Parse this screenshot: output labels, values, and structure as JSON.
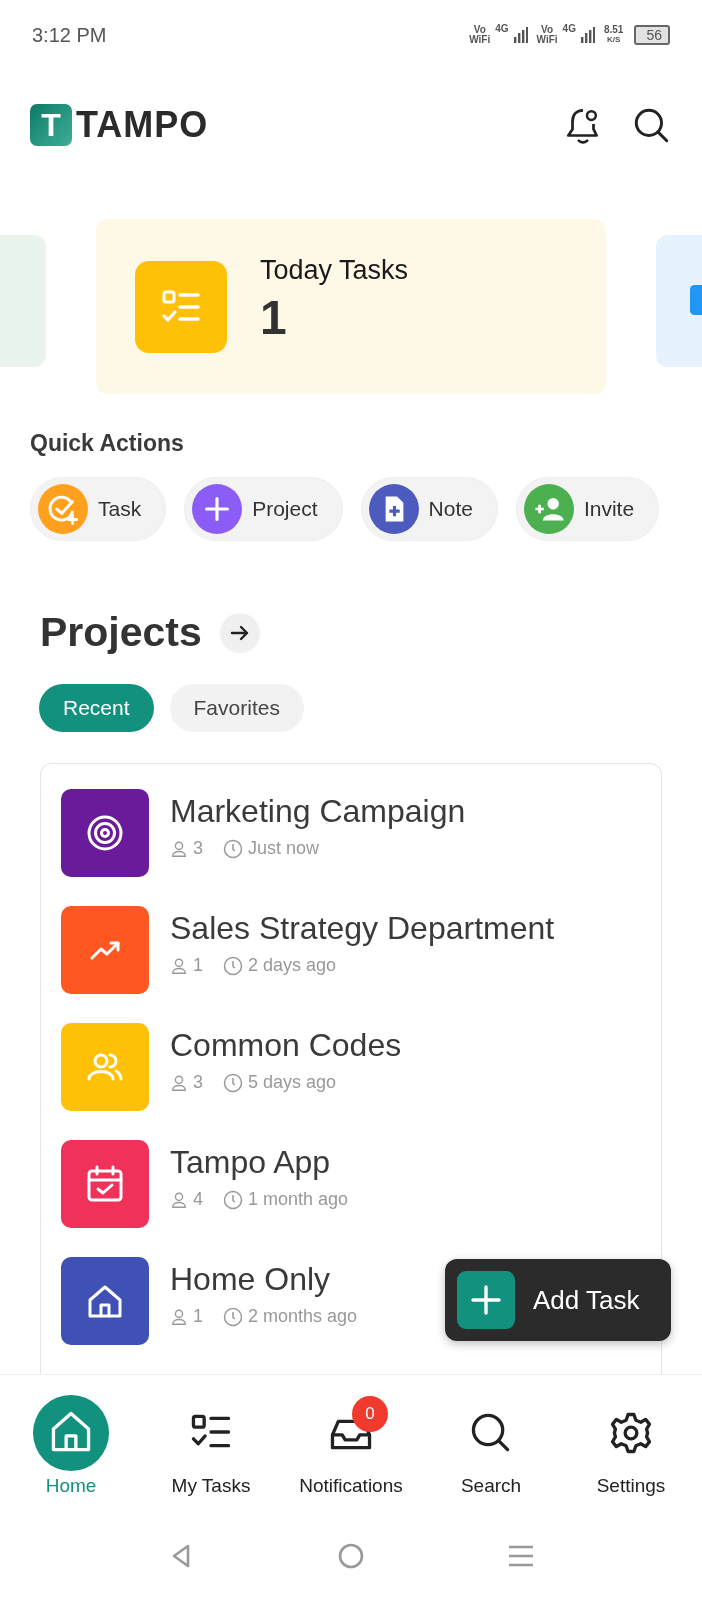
{
  "status_bar": {
    "time": "3:12 PM",
    "sims": [
      {
        "volte_top": "Vo",
        "volte_bottom": "WiFi",
        "network": "4G"
      },
      {
        "volte_top": "Vo",
        "volte_bottom": "WiFi",
        "network": "4G"
      }
    ],
    "speed": "8.51",
    "speed_unit": "K/S",
    "battery": "56"
  },
  "header": {
    "logo_letter": "T",
    "logo_text": "TAMPO"
  },
  "summary_cards": [
    {
      "kind": "partial_left",
      "color": "#e9f5ec"
    },
    {
      "kind": "main",
      "color": "#fef8e6",
      "title": "Today Tasks",
      "count": "1"
    },
    {
      "kind": "partial_right",
      "color": "#e6f2fd"
    }
  ],
  "quick_actions": {
    "title": "Quick Actions",
    "items": [
      {
        "label": "Task",
        "kind": "task",
        "color": "#ffa01f"
      },
      {
        "label": "Project",
        "kind": "plus",
        "color": "#8b5cf6"
      },
      {
        "label": "Note",
        "kind": "note",
        "color": "#4d5bbf"
      },
      {
        "label": "Invite",
        "kind": "invite",
        "color": "#4caf50"
      }
    ]
  },
  "projects": {
    "title": "Projects",
    "tabs": [
      {
        "label": "Recent",
        "selected": true
      },
      {
        "label": "Favorites",
        "selected": false
      }
    ],
    "items": [
      {
        "name": "Marketing Campaign",
        "kind": "target",
        "color": "#6a1b9a",
        "members": "3",
        "time": "Just now"
      },
      {
        "name": "Sales Strategy Department",
        "kind": "trend",
        "color": "#ff5722",
        "members": "1",
        "time": "2 days ago"
      },
      {
        "name": "Common Codes",
        "kind": "users",
        "color": "#ffc107",
        "members": "3",
        "time": "5 days ago"
      },
      {
        "name": "Tampo App",
        "kind": "calendar",
        "color": "#f0325a",
        "members": "4",
        "time": "1 month ago"
      },
      {
        "name": "Home Only",
        "kind": "home",
        "color": "#3f51b5",
        "members": "1",
        "time": "2 months ago"
      }
    ]
  },
  "fab": {
    "label": "Add Task"
  },
  "bottom_nav": [
    {
      "label": "Home",
      "kind": "home",
      "selected": true
    },
    {
      "label": "My Tasks",
      "kind": "tasks",
      "selected": false
    },
    {
      "label": "Notifications",
      "kind": "inbox",
      "selected": false,
      "badge": "0"
    },
    {
      "label": "Search",
      "kind": "search",
      "selected": false
    },
    {
      "label": "Settings",
      "kind": "gear",
      "selected": false
    }
  ]
}
